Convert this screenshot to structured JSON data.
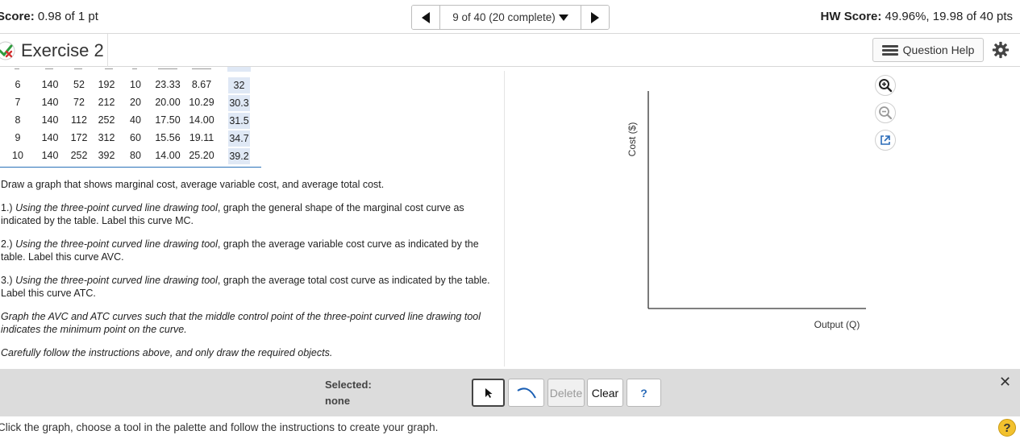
{
  "topbar": {
    "score_label": "Score:",
    "score_value": " 0.98 of 1 pt",
    "nav_position": "9 of 40 (20 complete)",
    "hw_label": "HW Score:",
    "hw_value": " 49.96%, 19.98 of 40 pts"
  },
  "exercise": {
    "title": "Exercise 2",
    "question_help": "Question Help"
  },
  "table": {
    "rows": [
      [
        "6",
        "140",
        "52",
        "192",
        "10",
        "23.33",
        "8.67",
        "32"
      ],
      [
        "7",
        "140",
        "72",
        "212",
        "20",
        "20.00",
        "10.29",
        "30.3"
      ],
      [
        "8",
        "140",
        "112",
        "252",
        "40",
        "17.50",
        "14.00",
        "31.5"
      ],
      [
        "9",
        "140",
        "172",
        "312",
        "60",
        "15.56",
        "19.11",
        "34.7"
      ],
      [
        "10",
        "140",
        "252",
        "392",
        "80",
        "14.00",
        "25.20",
        "39.2"
      ]
    ]
  },
  "instructions": {
    "p0": "Draw a graph that shows marginal cost, average variable cost, and average total cost.",
    "p1_prefix": "1.) ",
    "p1_italic": "Using the three-point curved line drawing tool",
    "p1_rest": ", graph the general shape of the marginal cost curve as indicated by the table. Label this curve MC.",
    "p2_prefix": "2.) ",
    "p2_italic": "Using the three-point curved line drawing tool",
    "p2_rest": ", graph the average variable cost curve as indicated by the table. Label this curve AVC.",
    "p3_prefix": "3.) ",
    "p3_italic": "Using the three-point curved line drawing tool",
    "p3_rest": ", graph the average total cost curve as indicated by the table. Label this curve ATC.",
    "p4": "Graph the AVC and ATC curves such that the middle control point of the three-point curved line drawing tool indicates the minimum point on the curve.",
    "p5": "Carefully follow the instructions above, and only draw the required objects."
  },
  "graph": {
    "y_label": "Cost ($)",
    "x_label": "Output (Q)"
  },
  "palette": {
    "selected_label": "Selected:",
    "selected_value": "none",
    "delete_label": "Delete",
    "clear_label": "Clear",
    "help_label": "?"
  },
  "status": {
    "text": "Click the graph, choose a tool in the palette and follow the instructions to create your graph.",
    "help_icon": "?"
  },
  "colors": {
    "answer_cell_bg": "#dfe8f5",
    "table_rule": "#2a73b8",
    "palette_bg": "#dcdcdc",
    "help_yellow": "#f2c12e",
    "curve_blue": "#1a5fb4"
  },
  "icons": [
    "check-x-icon",
    "list-icon",
    "gear-icon",
    "zoom-in-icon",
    "zoom-out-icon",
    "popout-icon",
    "pointer-icon",
    "curve-tool-icon",
    "close-icon",
    "help-icon"
  ]
}
